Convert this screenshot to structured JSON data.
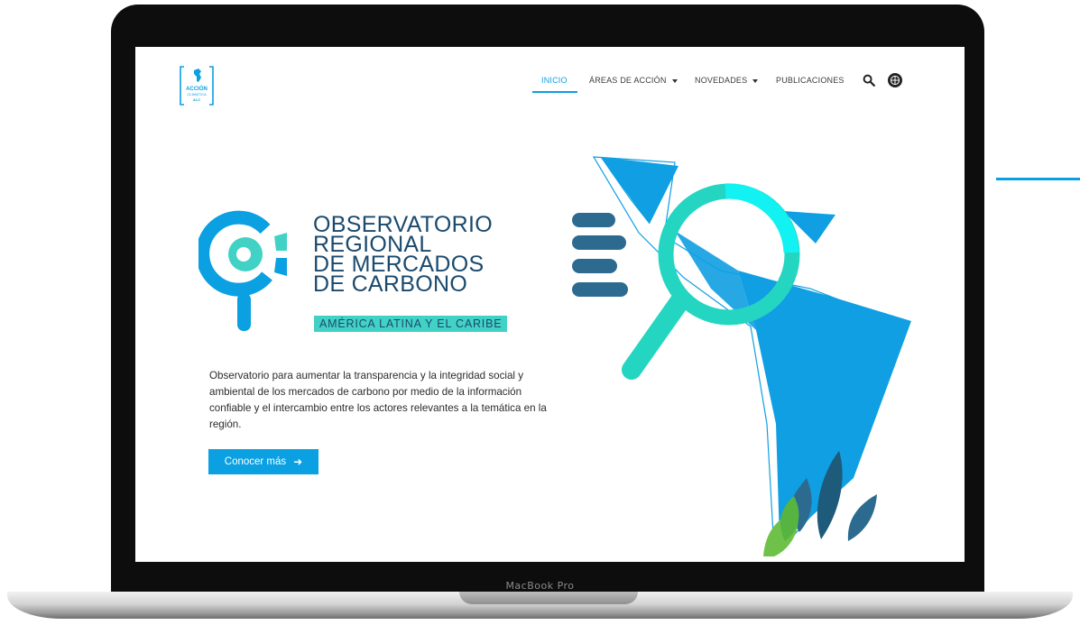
{
  "device": {
    "label": "MacBook Pro"
  },
  "site": {
    "logo": {
      "lines": [
        "ACCIÓN",
        "CLIMÁTICA",
        "ALC"
      ]
    }
  },
  "nav": {
    "items": [
      {
        "label": "INICIO",
        "active": true
      },
      {
        "label": "ÁREAS DE ACCIÓN",
        "has_dropdown": true
      },
      {
        "label": "NOVEDADES",
        "has_dropdown": true
      },
      {
        "label": "PUBLICACIONES"
      }
    ],
    "icons": [
      "search-icon",
      "language-icon"
    ]
  },
  "hero": {
    "title_lines": [
      "OBSERVATORIO",
      "REGIONAL",
      "DE MERCADOS",
      "DE CARBONO"
    ],
    "subtitle": "AMÉRICA LATINA Y EL CARIBE",
    "description": "Observatorio para aumentar la transparencia y la integridad social y ambiental de los mercados de carbono por medio de la información confiable y el intercambio entre los actores relevantes a la temática en la región.",
    "cta_label": "Conocer más",
    "cta_icon": "arrow-right-icon"
  },
  "colors": {
    "accent": "#0aa0e2",
    "navy": "#1a4a6e",
    "teal": "#42d1c5",
    "map_blue": "#0f9fe2",
    "bars": "#2c6b8f"
  }
}
